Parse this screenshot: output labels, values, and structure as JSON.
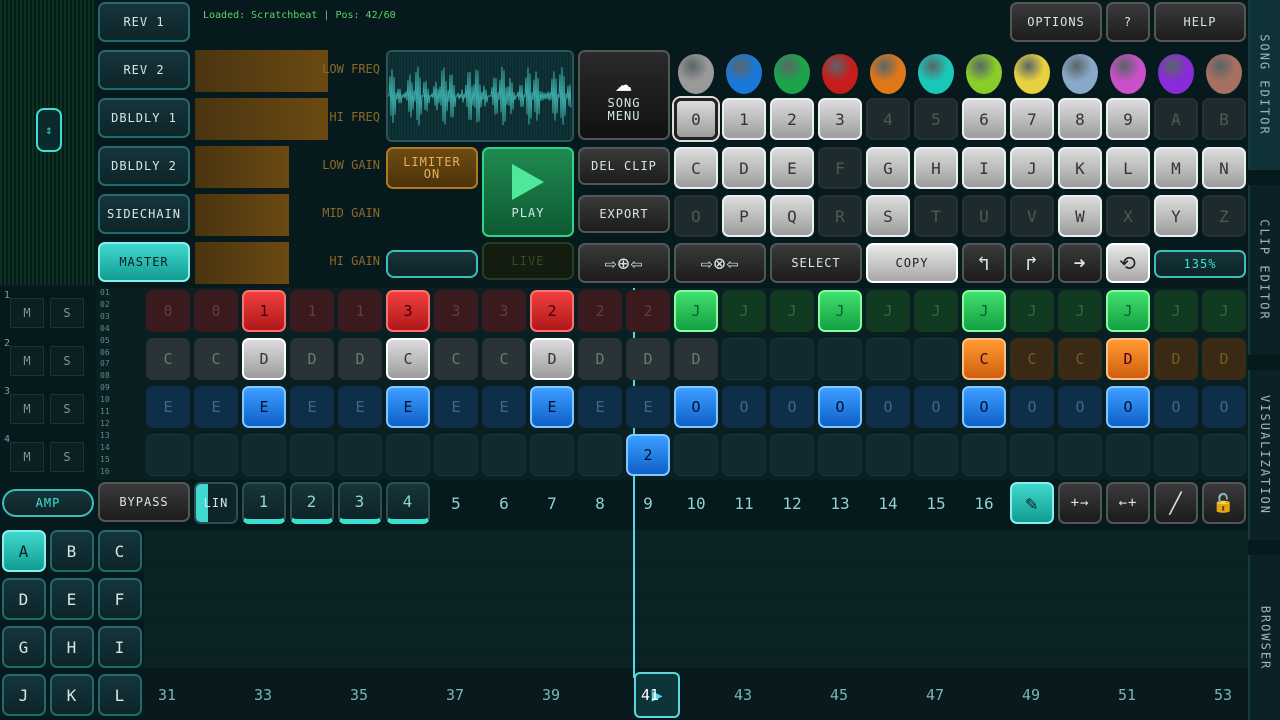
{
  "status": "Loaded: Scratchbeat | Pos: 42/60",
  "fx_buttons": [
    "REV 1",
    "REV 2",
    "DBLDLY 1",
    "DBLDLY 2",
    "SIDECHAIN",
    "MASTER"
  ],
  "sliders": [
    {
      "label": "LOW FREQ",
      "level": 0.71
    },
    {
      "label": "HI FREQ",
      "level": 0.71
    },
    {
      "label": "LOW GAIN",
      "level": 0.5
    },
    {
      "label": "MID GAIN",
      "level": 0.5
    },
    {
      "label": "HI GAIN",
      "level": 0.5
    }
  ],
  "limiter": "LIMITER\nON",
  "play": "PLAY",
  "live": "LIVE",
  "song_menu": "SONG\nMENU",
  "del_clip": "DEL CLIP",
  "export": "EXPORT",
  "select": "SELECT",
  "copy": "COPY",
  "zoom": "135%",
  "options": "OPTIONS",
  "help_q": "?",
  "help": "HELP",
  "side_tabs": [
    "SONG EDITOR",
    "CLIP EDITOR",
    "VISUALIZATION",
    "BROWSER"
  ],
  "pick_colors": [
    "#9a9a9a",
    "#1a78d8",
    "#1ca44a",
    "#c81c1c",
    "#e0781a",
    "#1ac8b8",
    "#8acc2a",
    "#e8d040",
    "#8aa8c8",
    "#c850c8",
    "#8a2ad8",
    "#a87060"
  ],
  "keys_row1": [
    "0",
    "1",
    "2",
    "3",
    "4",
    "5",
    "6",
    "7",
    "8",
    "9",
    "A",
    "B"
  ],
  "keys_row2": [
    "C",
    "D",
    "E",
    "F",
    "G",
    "H",
    "I",
    "J",
    "K",
    "L",
    "M",
    "N"
  ],
  "keys_row3": [
    "O",
    "P",
    "Q",
    "R",
    "S",
    "T",
    "U",
    "V",
    "W",
    "X",
    "Y",
    "Z"
  ],
  "track_labels": [
    "1",
    "2",
    "3",
    "4"
  ],
  "track_ms": [
    "M",
    "S"
  ],
  "row_numbers": [
    "01",
    "02",
    "03",
    "04",
    "05",
    "06",
    "07",
    "08",
    "09",
    "10",
    "11",
    "12",
    "13",
    "14",
    "15",
    "16"
  ],
  "track1": [
    "0",
    "0",
    "1",
    "1",
    "1",
    "3",
    "3",
    "3",
    "2",
    "2",
    "2",
    "J",
    "J",
    "J",
    "J",
    "J",
    "J",
    "J",
    "J",
    "J",
    "J",
    "J",
    "J"
  ],
  "track2": [
    "C",
    "C",
    "D",
    "D",
    "D",
    "C",
    "C",
    "C",
    "D",
    "D",
    "D",
    "D",
    "",
    "",
    "",
    "",
    "",
    "C",
    "C",
    "C",
    "D",
    "D",
    "D"
  ],
  "track3": [
    "E",
    "E",
    "E",
    "E",
    "E",
    "E",
    "E",
    "E",
    "E",
    "E",
    "E",
    "O",
    "O",
    "O",
    "O",
    "O",
    "O",
    "O",
    "O",
    "O",
    "O",
    "O",
    "O"
  ],
  "track4_cell": "2",
  "amp": "AMP",
  "bypass": "BYPASS",
  "lin": "LIN",
  "steps": [
    "1",
    "2",
    "3",
    "4",
    "5",
    "6",
    "7",
    "8",
    "9",
    "10",
    "11",
    "12",
    "13",
    "14",
    "15",
    "16"
  ],
  "letter_grid": [
    "A",
    "B",
    "C",
    "D",
    "E",
    "F",
    "G",
    "H",
    "I",
    "J",
    "K",
    "L"
  ],
  "timeline": [
    "31",
    "33",
    "35",
    "37",
    "39",
    "41",
    "43",
    "45",
    "47",
    "49",
    "51",
    "53"
  ]
}
